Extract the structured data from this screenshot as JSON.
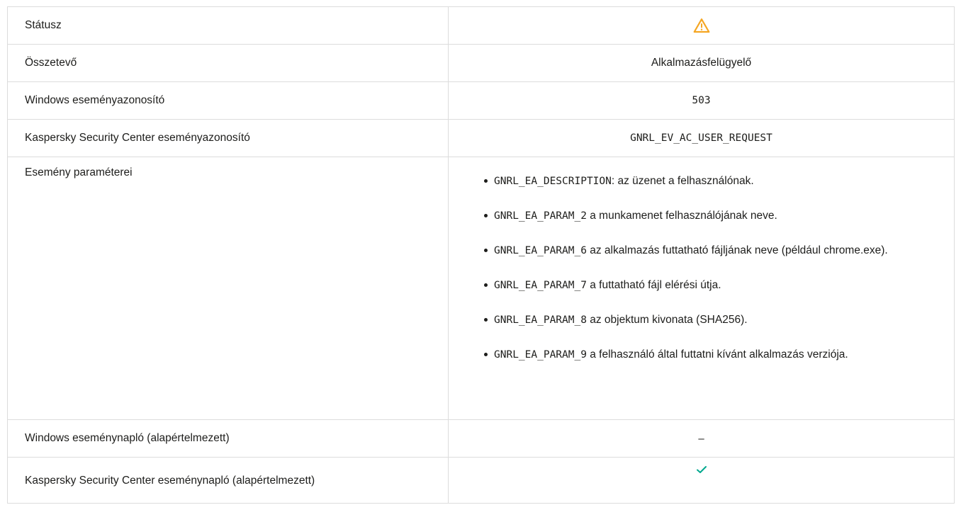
{
  "rows": {
    "status": {
      "label": "Státusz",
      "icon": "warning-icon",
      "icon_color": "#f5a623"
    },
    "component": {
      "label": "Összetevő",
      "value": "Alkalmazásfelügyelő"
    },
    "windows_event_id": {
      "label": "Windows eseményazonosító",
      "value": "503"
    },
    "ksc_event_id": {
      "label": "Kaspersky Security Center eseményazonosító",
      "value": "GNRL_EV_AC_USER_REQUEST"
    },
    "event_params": {
      "label": "Esemény paraméterei",
      "items": [
        {
          "code": "GNRL_EA_DESCRIPTION",
          "text": ": az üzenet a felhasználónak."
        },
        {
          "code": "GNRL_EA_PARAM_2",
          "text": " a munkamenet felhasználójának neve."
        },
        {
          "code": "GNRL_EA_PARAM_6",
          "text": " az alkalmazás futtatható fájljának neve (például chrome.exe)."
        },
        {
          "code": "GNRL_EA_PARAM_7",
          "text": " a futtatható fájl elérési útja."
        },
        {
          "code": "GNRL_EA_PARAM_8",
          "text": " az objektum kivonata (SHA256)."
        },
        {
          "code": "GNRL_EA_PARAM_9",
          "text": " a felhasználó által futtatni kívánt alkalmazás verziója."
        }
      ]
    },
    "windows_log": {
      "label": "Windows eseménynapló (alapértelmezett)",
      "value": "–"
    },
    "ksc_log": {
      "label": "Kaspersky Security Center eseménynapló (alapértelmezett)",
      "icon": "check-icon",
      "icon_color": "#00a88e"
    }
  }
}
